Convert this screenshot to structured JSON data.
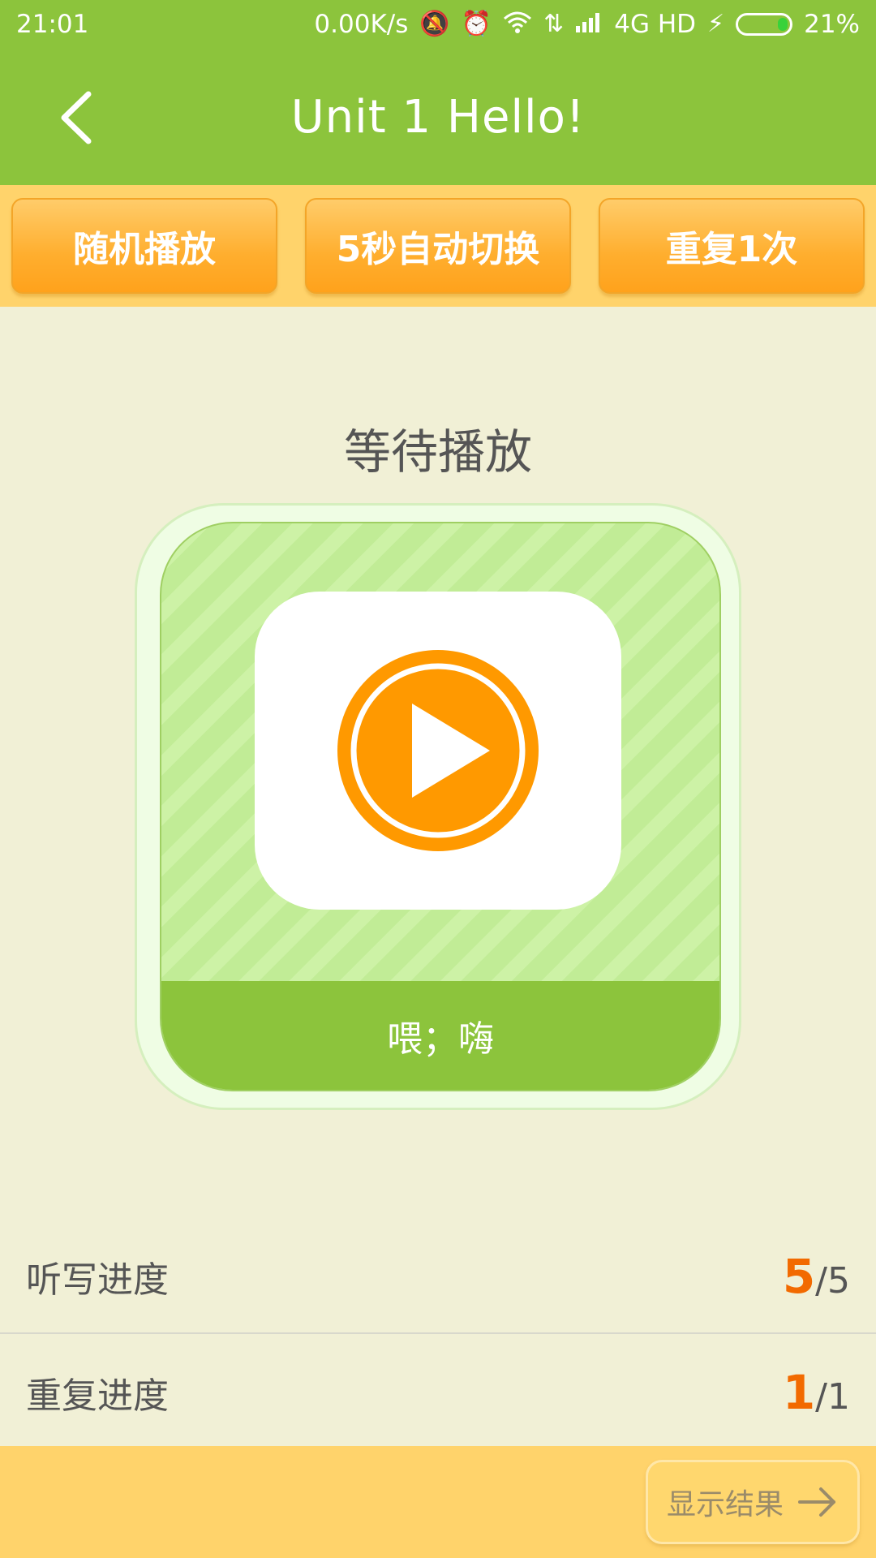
{
  "status_bar": {
    "time": "21:01",
    "net_speed": "0.00K/s",
    "network": "4G HD",
    "battery": "21%",
    "battery_level": 0.21
  },
  "header": {
    "title": "Unit 1 Hello!"
  },
  "toolbar": {
    "buttons": [
      {
        "label": "随机播放"
      },
      {
        "label": "5秒自动切换"
      },
      {
        "label": "重复1次"
      }
    ]
  },
  "player": {
    "status": "等待播放",
    "word": "喂；嗨"
  },
  "progress": {
    "dictation": {
      "label": "听写进度",
      "current": "5",
      "total": "/5"
    },
    "repeat": {
      "label": "重复进度",
      "current": "1",
      "total": "/1"
    }
  },
  "footer": {
    "show_result_label": "显示结果"
  },
  "colors": {
    "header_green": "#8cc43c",
    "toolbar_yellow": "#ffd36b",
    "button_orange": "#ffa21c",
    "play_orange": "#ff9900",
    "progress_orange": "#f26a00"
  }
}
